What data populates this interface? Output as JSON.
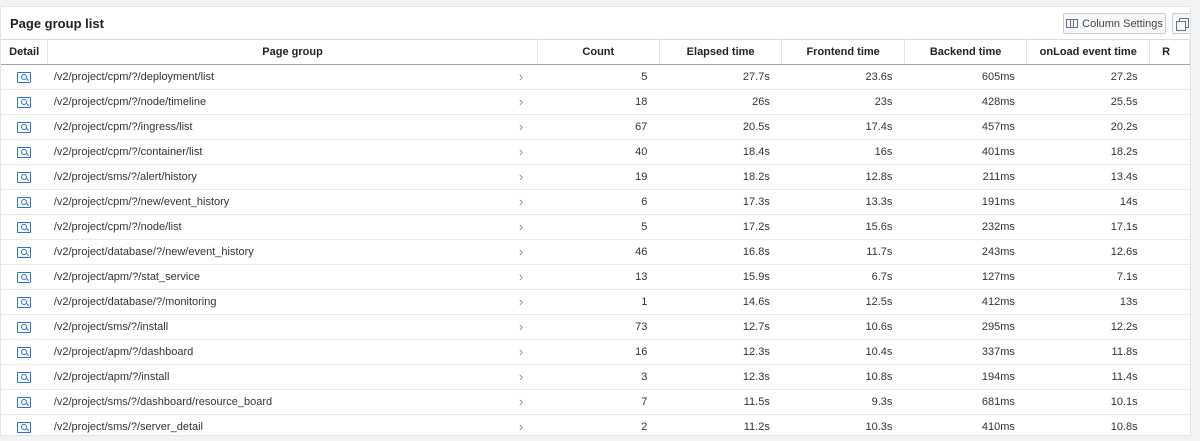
{
  "panel": {
    "title": "Page group list",
    "column_settings_label": "Column Settings"
  },
  "columns": [
    "Detail",
    "Page group",
    "Count",
    "Elapsed time",
    "Frontend time",
    "Backend time",
    "onLoad event time",
    "R"
  ],
  "rows": [
    {
      "page_group": "/v2/project/cpm/?/deployment/list",
      "count": "5",
      "elapsed": "27.7s",
      "frontend": "23.6s",
      "backend": "605ms",
      "onload": "27.2s"
    },
    {
      "page_group": "/v2/project/cpm/?/node/timeline",
      "count": "18",
      "elapsed": "26s",
      "frontend": "23s",
      "backend": "428ms",
      "onload": "25.5s"
    },
    {
      "page_group": "/v2/project/cpm/?/ingress/list",
      "count": "67",
      "elapsed": "20.5s",
      "frontend": "17.4s",
      "backend": "457ms",
      "onload": "20.2s"
    },
    {
      "page_group": "/v2/project/cpm/?/container/list",
      "count": "40",
      "elapsed": "18.4s",
      "frontend": "16s",
      "backend": "401ms",
      "onload": "18.2s"
    },
    {
      "page_group": "/v2/project/sms/?/alert/history",
      "count": "19",
      "elapsed": "18.2s",
      "frontend": "12.8s",
      "backend": "211ms",
      "onload": "13.4s"
    },
    {
      "page_group": "/v2/project/cpm/?/new/event_history",
      "count": "6",
      "elapsed": "17.3s",
      "frontend": "13.3s",
      "backend": "191ms",
      "onload": "14s"
    },
    {
      "page_group": "/v2/project/cpm/?/node/list",
      "count": "5",
      "elapsed": "17.2s",
      "frontend": "15.6s",
      "backend": "232ms",
      "onload": "17.1s"
    },
    {
      "page_group": "/v2/project/database/?/new/event_history",
      "count": "46",
      "elapsed": "16.8s",
      "frontend": "11.7s",
      "backend": "243ms",
      "onload": "12.6s"
    },
    {
      "page_group": "/v2/project/apm/?/stat_service",
      "count": "13",
      "elapsed": "15.9s",
      "frontend": "6.7s",
      "backend": "127ms",
      "onload": "7.1s"
    },
    {
      "page_group": "/v2/project/database/?/monitoring",
      "count": "1",
      "elapsed": "14.6s",
      "frontend": "12.5s",
      "backend": "412ms",
      "onload": "13s"
    },
    {
      "page_group": "/v2/project/sms/?/install",
      "count": "73",
      "elapsed": "12.7s",
      "frontend": "10.6s",
      "backend": "295ms",
      "onload": "12.2s"
    },
    {
      "page_group": "/v2/project/apm/?/dashboard",
      "count": "16",
      "elapsed": "12.3s",
      "frontend": "10.4s",
      "backend": "337ms",
      "onload": "11.8s"
    },
    {
      "page_group": "/v2/project/apm/?/install",
      "count": "3",
      "elapsed": "12.3s",
      "frontend": "10.8s",
      "backend": "194ms",
      "onload": "11.4s"
    },
    {
      "page_group": "/v2/project/sms/?/dashboard/resource_board",
      "count": "7",
      "elapsed": "11.5s",
      "frontend": "9.3s",
      "backend": "681ms",
      "onload": "10.1s"
    },
    {
      "page_group": "/v2/project/sms/?/server_detail",
      "count": "2",
      "elapsed": "11.2s",
      "frontend": "10.3s",
      "backend": "410ms",
      "onload": "10.8s"
    }
  ],
  "icons": {
    "detail": "detail-search-icon",
    "row_chevron": "chevron-right-icon",
    "column_settings": "columns-icon",
    "copy": "copy-icon"
  },
  "colors": {
    "accent": "#2d6fd8",
    "header_border": "#9ea4ab",
    "row_border": "#e8eaed",
    "background": "#f2f3f5"
  }
}
